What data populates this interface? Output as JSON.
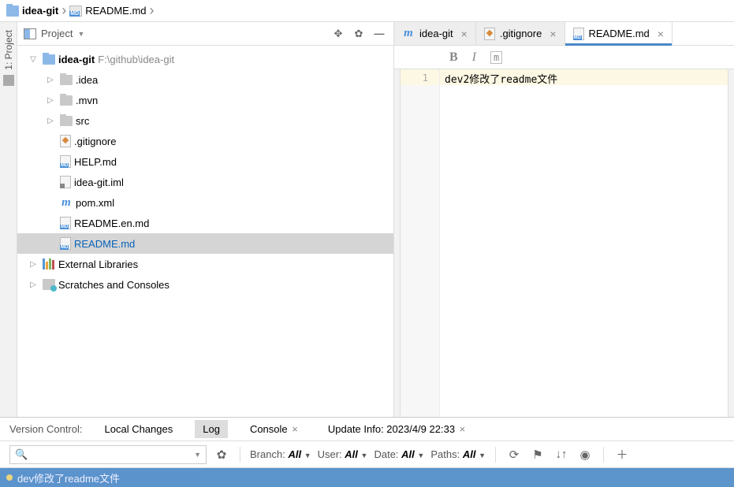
{
  "breadcrumb": {
    "root": "idea-git",
    "file": "README.md"
  },
  "project": {
    "title": "Project",
    "gutter_label": "1: Project",
    "root_name": "idea-git",
    "root_path": "F:\\github\\idea-git",
    "folders": {
      "idea": ".idea",
      "mvn": ".mvn",
      "src": "src"
    },
    "files": {
      "gitignore": ".gitignore",
      "help": "HELP.md",
      "iml": "idea-git.iml",
      "pom": "pom.xml",
      "readme_en": "README.en.md",
      "readme": "README.md"
    },
    "external": "External Libraries",
    "scratches": "Scratches and Consoles"
  },
  "tabs": {
    "t1": "idea-git",
    "t2": ".gitignore",
    "t3": "README.md"
  },
  "editor": {
    "line1_num": "1",
    "line1_text": "dev2修改了readme文件"
  },
  "bottom": {
    "vc_label": "Version Control:",
    "local": "Local Changes",
    "log": "Log",
    "console": "Console",
    "update_info": "Update Info: 2023/4/9 22:33",
    "branch": "Branch:",
    "all": "All",
    "user": "User:",
    "date": "Date:",
    "paths": "Paths:",
    "commit": "dev修改了readme文件"
  }
}
